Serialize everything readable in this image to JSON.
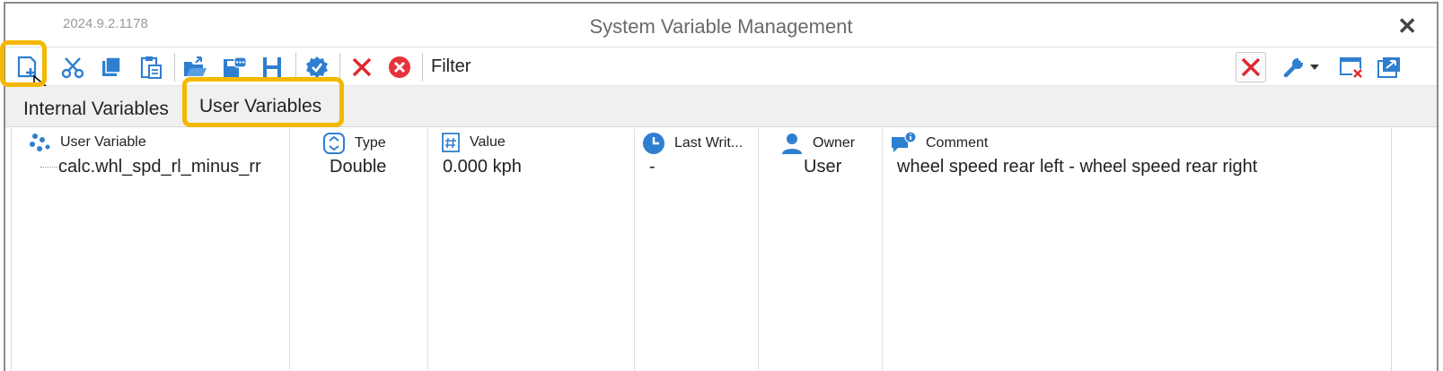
{
  "window": {
    "version": "2024.9.2.1178",
    "title": "System Variable Management",
    "close_symbol": "✕"
  },
  "toolbar": {
    "icons": [
      "new-variable-icon",
      "cut-icon",
      "copy-icon",
      "paste-icon",
      "open-folder-icon",
      "save-icon",
      "h-icon",
      "verify-badge-icon",
      "delete-icon",
      "remove-circle-icon"
    ],
    "filter_label": "Filter",
    "right_icons": [
      "clear-filter-icon",
      "wrench-icon",
      "dropdown-arrow-icon",
      "close-window-icon",
      "export-window-icon"
    ]
  },
  "tabs": {
    "internal": "Internal Variables",
    "user": "User Variables",
    "active": "User Variables"
  },
  "grid": {
    "columns": [
      {
        "label": "User Variable",
        "icon": "dots-icon"
      },
      {
        "label": "Type",
        "icon": "type-stepper-icon"
      },
      {
        "label": "Value",
        "icon": "hash-icon"
      },
      {
        "label": "Last Writ...",
        "icon": "clock-icon"
      },
      {
        "label": "Owner",
        "icon": "person-icon"
      },
      {
        "label": "Comment",
        "icon": "comment-icon"
      }
    ],
    "rows": [
      {
        "name": "calc.whl_spd_rl_minus_rr",
        "type": "Double",
        "value": "0.000 kph",
        "last_write": "-",
        "owner": "User",
        "comment": "wheel speed rear left - wheel speed rear right"
      }
    ]
  },
  "colors": {
    "accent_blue": "#2f7fd0",
    "delete_red": "#e0282e",
    "highlight": "#f5b800"
  }
}
